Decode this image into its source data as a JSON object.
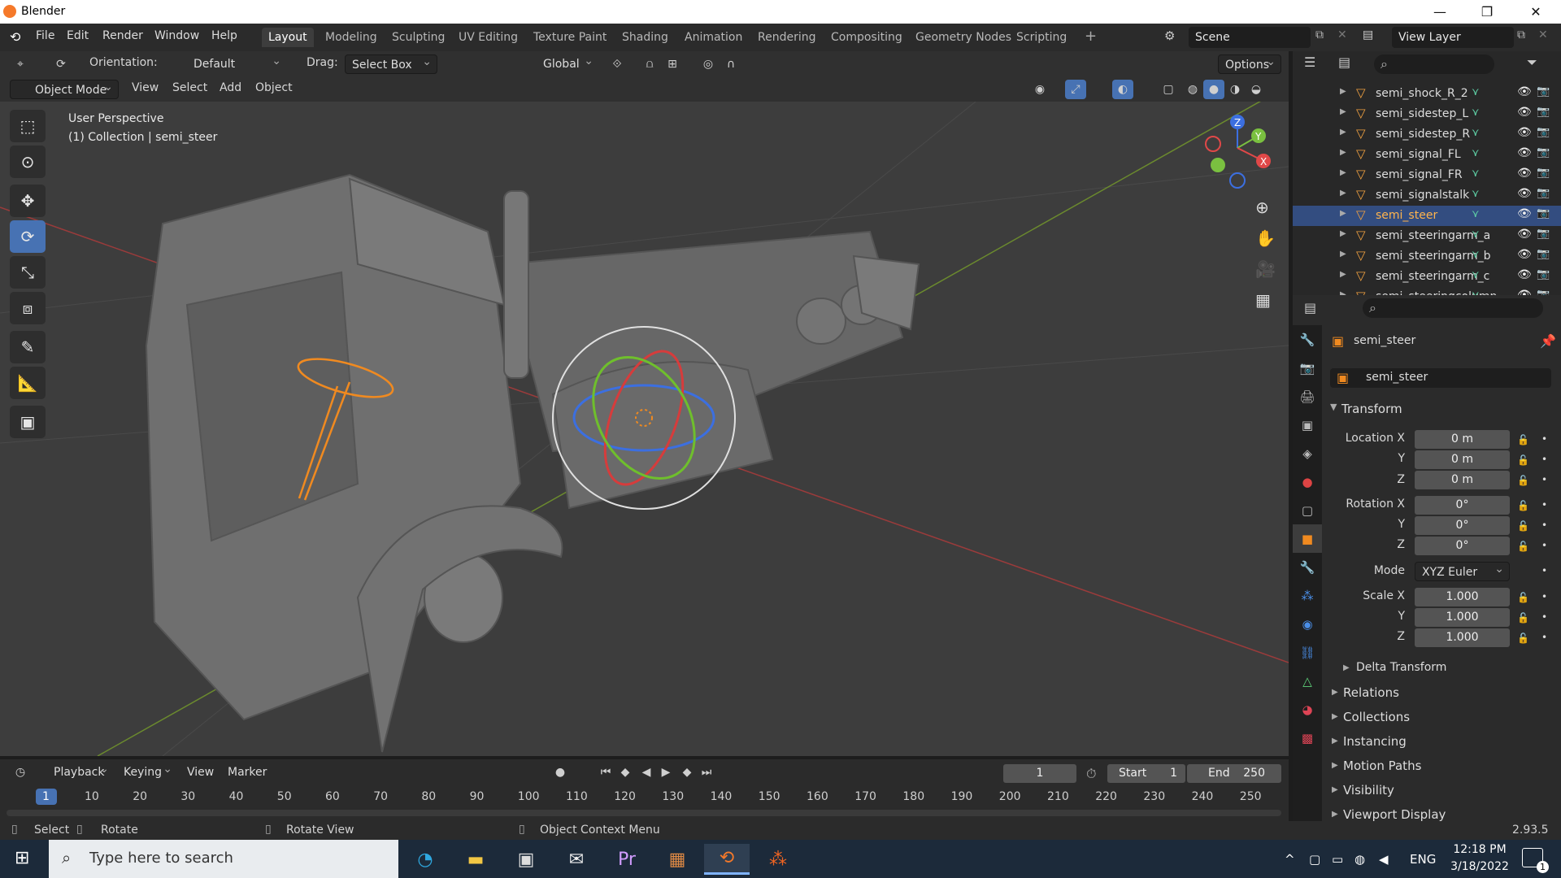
{
  "window": {
    "title": "Blender",
    "minimize": "—",
    "maximize": "❐",
    "close": "✕"
  },
  "menu": {
    "items": [
      "File",
      "Edit",
      "Render",
      "Window",
      "Help"
    ]
  },
  "workspaces": [
    "Layout",
    "Modeling",
    "Sculpting",
    "UV Editing",
    "Texture Paint",
    "Shading",
    "Animation",
    "Rendering",
    "Compositing",
    "Geometry Nodes",
    "Scripting"
  ],
  "active_workspace": "Layout",
  "scene": {
    "name": "Scene",
    "view_layer": "View Layer"
  },
  "toolbar": {
    "orientation_label": "Orientation:",
    "orientation_value": "Default",
    "drag_label": "Drag:",
    "drag_value": "Select Box",
    "transform_space": "Global",
    "options_label": "Options"
  },
  "header": {
    "mode": "Object Mode",
    "menus": [
      "View",
      "Select",
      "Add",
      "Object"
    ]
  },
  "viewport": {
    "perspective": "User Perspective",
    "collection_info": "(1) Collection | semi_steer",
    "axis_labels": [
      "Z",
      "Y",
      "X"
    ]
  },
  "outliner": {
    "items": [
      {
        "name": "semi_shock_R_2",
        "selected": false
      },
      {
        "name": "semi_sidestep_L",
        "selected": false
      },
      {
        "name": "semi_sidestep_R",
        "selected": false
      },
      {
        "name": "semi_signal_FL",
        "selected": false
      },
      {
        "name": "semi_signal_FR",
        "selected": false
      },
      {
        "name": "semi_signalstalk",
        "selected": false
      },
      {
        "name": "semi_steer",
        "selected": true
      },
      {
        "name": "semi_steeringarm_a",
        "selected": false
      },
      {
        "name": "semi_steeringarm_b",
        "selected": false
      },
      {
        "name": "semi_steeringarm_c",
        "selected": false
      },
      {
        "name": "semi_steeringcolumn",
        "selected": false
      }
    ]
  },
  "properties": {
    "object_name": "semi_steer",
    "data_name": "semi_steer",
    "transform_label": "Transform",
    "location_label": "Location X",
    "rotation_label": "Rotation X",
    "scale_label": "Scale X",
    "axis_y": "Y",
    "axis_z": "Z",
    "location": [
      "0 m",
      "0 m",
      "0 m"
    ],
    "rotation": [
      "0°",
      "0°",
      "0°"
    ],
    "mode_label": "Mode",
    "mode_value": "XYZ Euler",
    "scale": [
      "1.000",
      "1.000",
      "1.000"
    ],
    "subpanels": [
      "Delta Transform"
    ],
    "panels": [
      "Relations",
      "Collections",
      "Instancing",
      "Motion Paths",
      "Visibility",
      "Viewport Display"
    ]
  },
  "timeline": {
    "menus": [
      "Playback",
      "Keying",
      "View",
      "Marker"
    ],
    "current_frame": "1",
    "start_label": "Start",
    "start": "1",
    "end_label": "End",
    "end": "250",
    "ticks": [
      "1",
      "10",
      "20",
      "30",
      "40",
      "50",
      "60",
      "70",
      "80",
      "90",
      "100",
      "110",
      "120",
      "130",
      "140",
      "150",
      "160",
      "170",
      "180",
      "190",
      "200",
      "210",
      "220",
      "230",
      "240",
      "250"
    ]
  },
  "status": {
    "select": "Select",
    "rotate": "Rotate",
    "rotate_view": "Rotate View",
    "context_menu": "Object Context Menu",
    "version": "2.93.5"
  },
  "taskbar": {
    "search_placeholder": "Type here to search",
    "language": "ENG",
    "time": "12:18 PM",
    "date": "3/18/2022",
    "notification_count": "1"
  },
  "colors": {
    "accent": "#4772b3",
    "selection": "#334d80",
    "object_orange": "#f0a040"
  }
}
